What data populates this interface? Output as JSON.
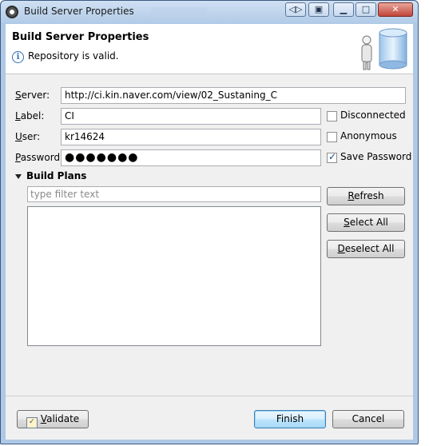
{
  "window": {
    "title": "Build Server Properties",
    "controls": {
      "restore": "◁▷",
      "pin": "▣",
      "minimize": "▁",
      "maximize": "□",
      "close": "✕"
    }
  },
  "header": {
    "title": "Build Server Properties",
    "message": "Repository is valid.",
    "info_glyph": "i"
  },
  "form": {
    "server": {
      "label": "Server:",
      "value": "http://ci.kin.naver.com/view/02_Sustaning_C"
    },
    "label": {
      "label": "Label:",
      "value": "CI"
    },
    "user": {
      "label": "User:",
      "value": "kr14624"
    },
    "password": {
      "label": "Password:",
      "value": "●●●●●●●"
    }
  },
  "options": {
    "disconnected": {
      "label": "Disconnected",
      "checked": false
    },
    "anonymous": {
      "label": "Anonymous",
      "checked": false
    },
    "save_password": {
      "label": "Save Password",
      "checked": true
    }
  },
  "build_plans": {
    "title": "Build Plans",
    "filter_placeholder": "type filter text",
    "refresh": "Refresh",
    "select_all": "Select All",
    "deselect_all": "Deselect All"
  },
  "footer": {
    "validate": "Validate",
    "finish": "Finish",
    "cancel": "Cancel"
  },
  "colors": {
    "accent": "#3c7fb1",
    "info": "#2d6fb7",
    "titlebar": "#b2cbe7"
  }
}
